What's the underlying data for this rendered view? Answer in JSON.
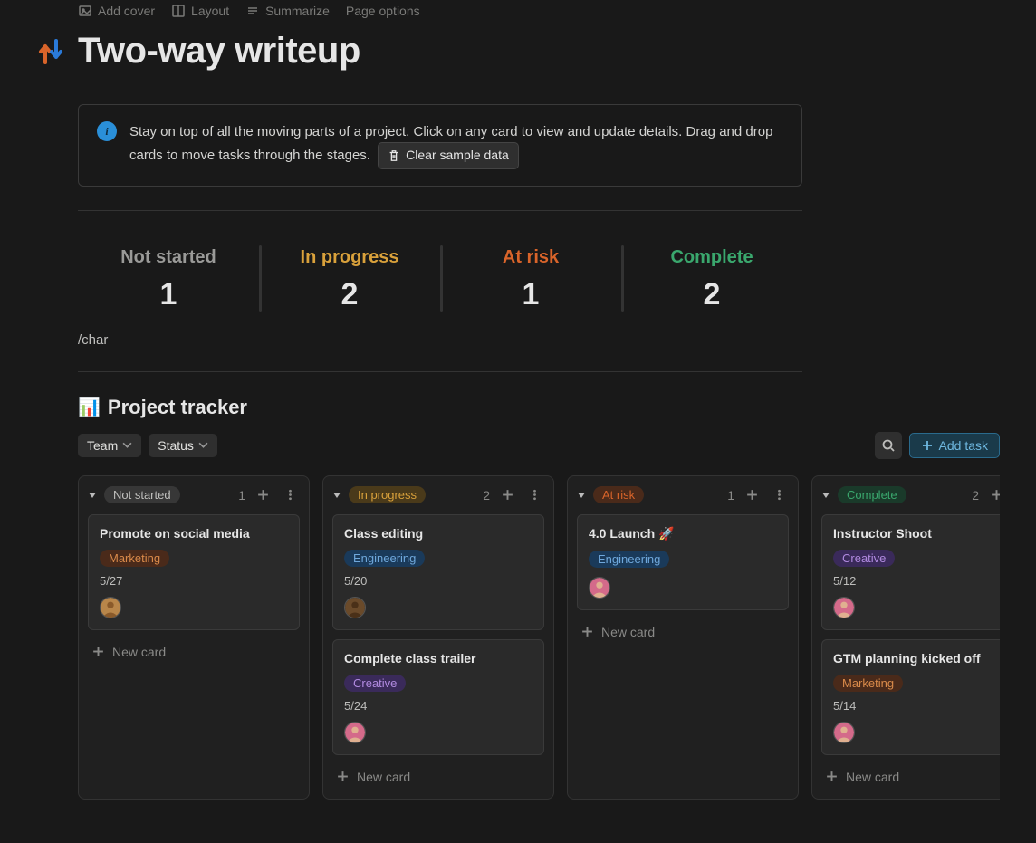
{
  "toolbar": {
    "add_cover": "Add cover",
    "layout": "Layout",
    "summarize": "Summarize",
    "page_options": "Page options"
  },
  "page": {
    "title": "Two-way writeup",
    "icon_alt": "two-way-arrows"
  },
  "callout": {
    "text": "Stay on top of all the moving parts of a project. Click on any card to view and update details. Drag and drop cards to move tasks through the stages.",
    "button": "Clear sample data"
  },
  "stats": [
    {
      "label": "Not started",
      "value": "1",
      "color": "#9a9a98"
    },
    {
      "label": "In progress",
      "value": "2",
      "color": "#d9a13b"
    },
    {
      "label": "At risk",
      "value": "1",
      "color": "#d9642a"
    },
    {
      "label": "Complete",
      "value": "2",
      "color": "#3aa76d"
    }
  ],
  "slash": "/char",
  "tracker": {
    "title": "Project tracker",
    "filters": {
      "team": "Team",
      "status": "Status"
    },
    "add_task": "Add task",
    "new_card": "New card"
  },
  "colors": {
    "grey_pill_bg": "#373737",
    "grey_pill_fg": "#c0c0be",
    "yellow_pill_bg": "#4a3a1a",
    "yellow_pill_fg": "#d9a13b",
    "orange_pill_bg": "#4a2a1a",
    "orange_pill_fg": "#d9642a",
    "green_pill_bg": "#1a3a2a",
    "green_pill_fg": "#3aa76d",
    "tag_marketing_bg": "#4a2a1a",
    "tag_marketing_fg": "#d98a4a",
    "tag_engineering_bg": "#1a3a5a",
    "tag_engineering_fg": "#6fa8dc",
    "tag_creative_bg": "#3a2a5a",
    "tag_creative_fg": "#b18ae0"
  },
  "columns": [
    {
      "status": "Not started",
      "count": "1",
      "pill_bg": "#373737",
      "pill_fg": "#c0c0be",
      "cards": [
        {
          "title": "Promote on social media",
          "tag": "Marketing",
          "tag_bg": "#4a2a1a",
          "tag_fg": "#d98a4a",
          "date": "5/27",
          "avatar": {
            "bg": "#b8864a",
            "skin": "#8a5a2a"
          }
        }
      ]
    },
    {
      "status": "In progress",
      "count": "2",
      "pill_bg": "#4a3a1a",
      "pill_fg": "#d9a13b",
      "cards": [
        {
          "title": "Class editing",
          "tag": "Engineering",
          "tag_bg": "#1a3a5a",
          "tag_fg": "#6fa8dc",
          "date": "5/20",
          "avatar": {
            "bg": "#6a4a2a",
            "skin": "#4a3018"
          }
        },
        {
          "title": "Complete class trailer",
          "tag": "Creative",
          "tag_bg": "#3a2a5a",
          "tag_fg": "#b18ae0",
          "date": "5/24",
          "avatar": {
            "bg": "#d46a8a",
            "skin": "#e0b090"
          }
        }
      ]
    },
    {
      "status": "At risk",
      "count": "1",
      "pill_bg": "#4a2a1a",
      "pill_fg": "#d9642a",
      "cards": [
        {
          "title": "4.0 Launch 🚀",
          "tag": "Engineering",
          "tag_bg": "#1a3a5a",
          "tag_fg": "#6fa8dc",
          "date": "",
          "avatar": {
            "bg": "#d46a8a",
            "skin": "#e0b090"
          }
        }
      ]
    },
    {
      "status": "Complete",
      "count": "2",
      "pill_bg": "#1a3a2a",
      "pill_fg": "#3aa76d",
      "cards": [
        {
          "title": "Instructor Shoot",
          "tag": "Creative",
          "tag_bg": "#3a2a5a",
          "tag_fg": "#b18ae0",
          "date": "5/12",
          "avatar": {
            "bg": "#d46a8a",
            "skin": "#e0b090"
          }
        },
        {
          "title": "GTM planning kicked off",
          "tag": "Marketing",
          "tag_bg": "#4a2a1a",
          "tag_fg": "#d98a4a",
          "date": "5/14",
          "avatar": {
            "bg": "#d46a8a",
            "skin": "#e0b090"
          }
        }
      ]
    }
  ]
}
